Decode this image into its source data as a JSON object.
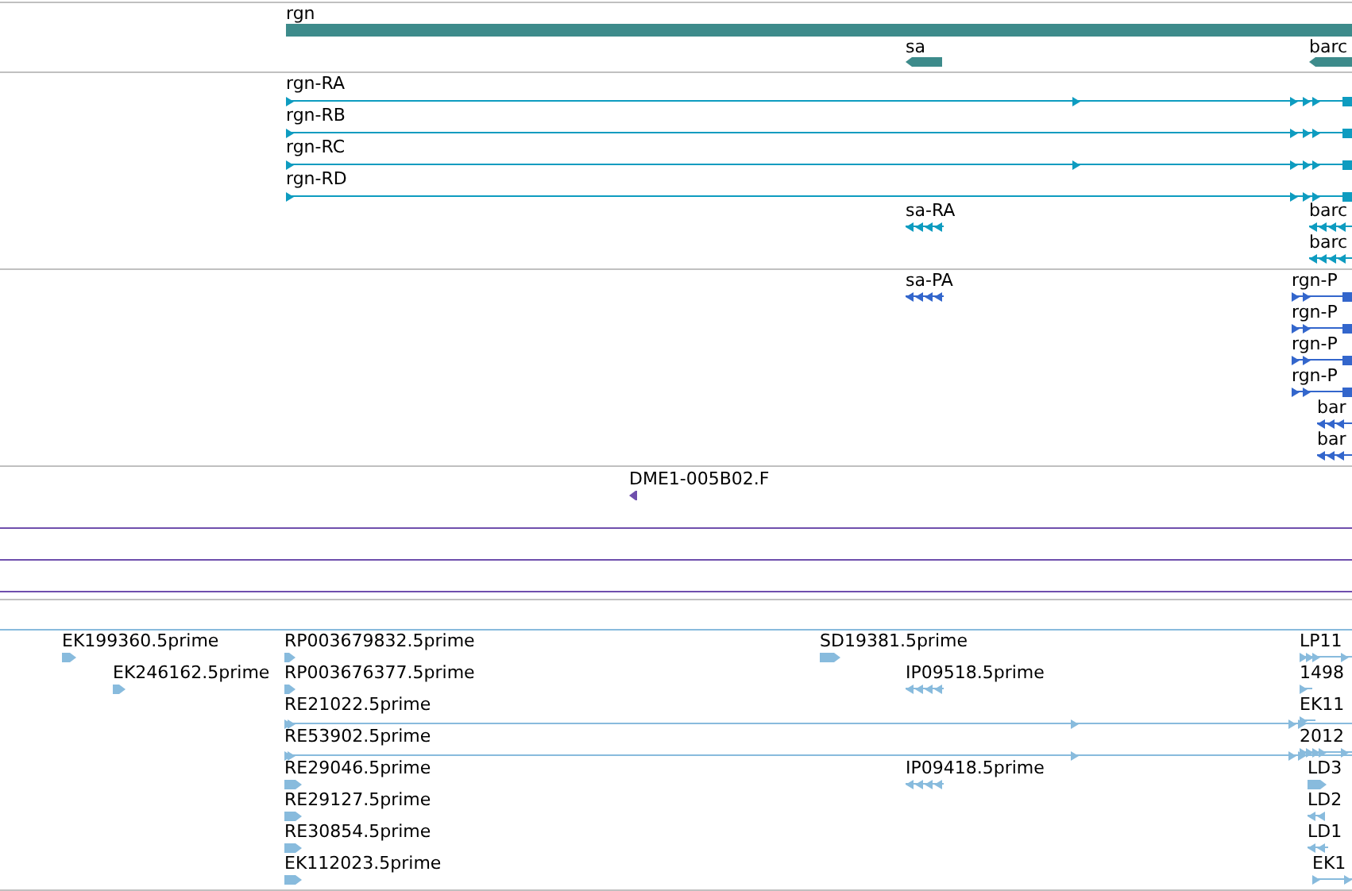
{
  "tracks": [
    {
      "color": "#3d8b8b",
      "features": [
        {
          "label": "rgn"
        },
        {
          "label": "sa",
          "reverse": true
        },
        {
          "label": "barc",
          "reverse": true
        }
      ]
    },
    {
      "color": "#0e9cc0",
      "features": [
        {
          "label": "rgn-RA",
          "reverse": false
        },
        {
          "label": "rgn-RB",
          "reverse": false
        },
        {
          "label": "rgn-RC",
          "reverse": false
        },
        {
          "label": "rgn-RD",
          "reverse": false
        },
        {
          "label": "sa-RA",
          "reverse": true
        },
        {
          "label": "barc",
          "reverse": true
        },
        {
          "label": "barc",
          "reverse": true
        }
      ]
    },
    {
      "color": "#3366cc",
      "features": [
        {
          "label": "sa-PA",
          "reverse": true
        },
        {
          "label": "rgn-P",
          "reverse": false
        },
        {
          "label": "rgn-P",
          "reverse": false
        },
        {
          "label": "rgn-P",
          "reverse": false
        },
        {
          "label": "rgn-P",
          "reverse": false
        },
        {
          "label": "bar",
          "reverse": true
        },
        {
          "label": "bar",
          "reverse": true
        }
      ]
    },
    {
      "color": "#6f4fad",
      "features": [
        {
          "label": "DME1-005B02.F",
          "reverse": true
        }
      ]
    },
    {
      "color": "#88bbdd",
      "features": [
        {
          "label": "EK199360.5prime",
          "reverse": false
        },
        {
          "label": "EK246162.5prime",
          "reverse": false
        },
        {
          "label": "RP003679832.5prime",
          "reverse": false
        },
        {
          "label": "RP003676377.5prime",
          "reverse": false
        },
        {
          "label": "RE21022.5prime",
          "reverse": false
        },
        {
          "label": "RE53902.5prime",
          "reverse": false
        },
        {
          "label": "RE29046.5prime",
          "reverse": false
        },
        {
          "label": "RE29127.5prime",
          "reverse": false
        },
        {
          "label": "RE30854.5prime",
          "reverse": false
        },
        {
          "label": "EK112023.5prime",
          "reverse": false
        },
        {
          "label": "SD19381.5prime",
          "reverse": false
        },
        {
          "label": "IP09518.5prime",
          "reverse": true
        },
        {
          "label": "IP09418.5prime",
          "reverse": true
        },
        {
          "label": "LP11",
          "reverse": false
        },
        {
          "label": "1498",
          "reverse": false
        },
        {
          "label": "EK11",
          "reverse": false
        },
        {
          "label": "2012",
          "reverse": false
        },
        {
          "label": "LD3",
          "reverse": false
        },
        {
          "label": "LD2",
          "reverse": true
        },
        {
          "label": "LD1",
          "reverse": true
        },
        {
          "label": "EK1",
          "reverse": false
        }
      ]
    }
  ]
}
